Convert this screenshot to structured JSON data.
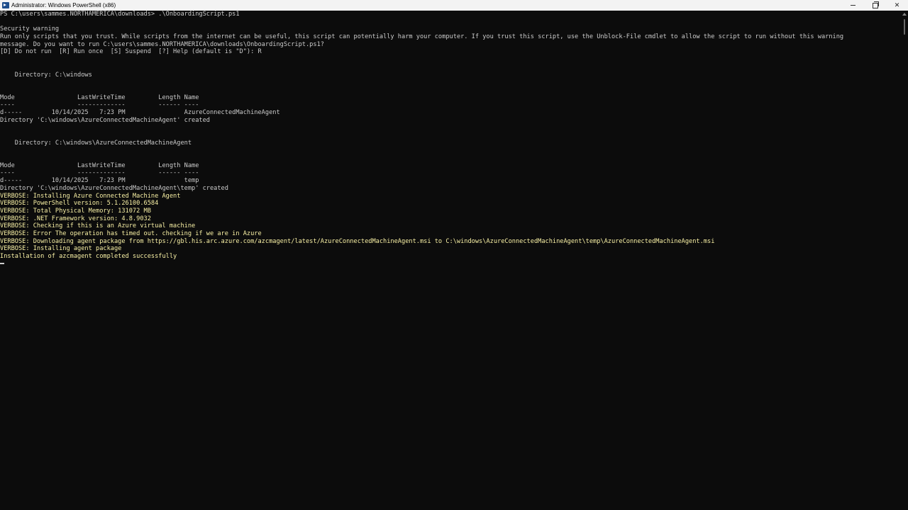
{
  "window": {
    "title": "Administrator: Windows PowerShell (x86)",
    "controls": {
      "minimize": "minimize",
      "maximize": "maximize",
      "close": "✕"
    }
  },
  "console": {
    "lines": [
      "PS C:\\users\\sammes.NORTHAMERICA\\downloads> .\\OnboardingScript.ps1",
      "",
      "Security warning",
      "Run only scripts that you trust. While scripts from the internet can be useful, this script can potentially harm your computer. If you trust this script, use the Unblock-File cmdlet to allow the script to run without this warning",
      "message. Do you want to run C:\\users\\sammes.NORTHAMERICA\\downloads\\OnboardingScript.ps1?",
      "[D] Do not run  [R] Run once  [S] Suspend  [?] Help (default is \"D\"): R",
      "",
      "",
      "    Directory: C:\\windows",
      "",
      "",
      "Mode                 LastWriteTime         Length Name",
      "----                 -------------         ------ ----",
      "d-----        10/14/2025   7:23 PM                AzureConnectedMachineAgent",
      "Directory 'C:\\windows\\AzureConnectedMachineAgent' created",
      "",
      "",
      "    Directory: C:\\windows\\AzureConnectedMachineAgent",
      "",
      "",
      "Mode                 LastWriteTime         Length Name",
      "----                 -------------         ------ ----",
      "d-----        10/14/2025   7:23 PM                temp",
      "Directory 'C:\\windows\\AzureConnectedMachineAgent\\temp' created",
      "VERBOSE: Installing Azure Connected Machine Agent",
      "VERBOSE: PowerShell version: 5.1.26100.6584",
      "VERBOSE: Total Physical Memory: 131072 MB",
      "VERBOSE: .NET Framework version: 4.8.9032",
      "VERBOSE: Checking if this is an Azure virtual machine",
      "VERBOSE: Error The operation has timed out. checking if we are in Azure",
      "VERBOSE: Downloading agent package from https://gbl.his.arc.azure.com/azcmagent/latest/AzureConnectedMachineAgent.msi to C:\\windows\\AzureConnectedMachineAgent\\temp\\AzureConnectedMachineAgent.msi",
      "VERBOSE: Installing agent package",
      "Installation of azcmagent completed successfully"
    ],
    "verbose_color": "#f9f1a5",
    "text_color": "#cccccc",
    "background": "#0c0c0c"
  }
}
